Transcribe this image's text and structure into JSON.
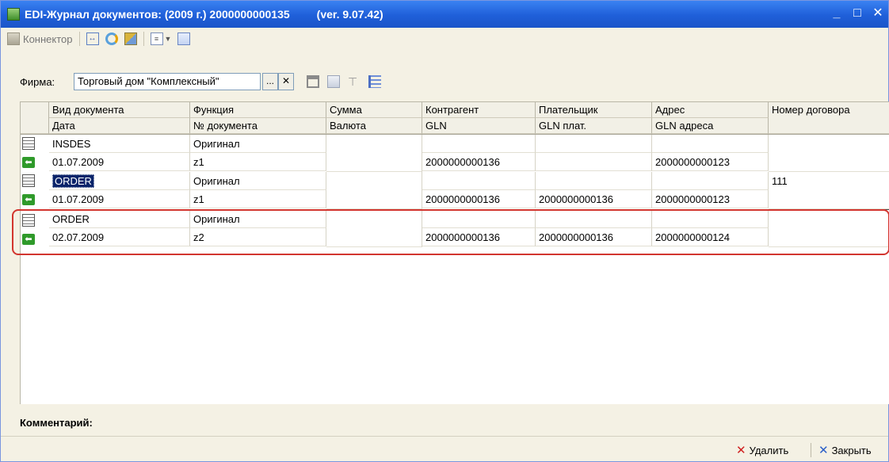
{
  "window": {
    "title": "EDI-Журнал документов: (2009 г.) 2000000000135",
    "version": "(ver. 9.07.42)",
    "minimize": "_",
    "maximize": "□",
    "close": "✕"
  },
  "toolbar": {
    "connector_label": "Коннектор"
  },
  "firm": {
    "label": "Фирма:",
    "value": "Торговый дом \"Комплексный\"",
    "pick_label": "...",
    "clear_label": "✕"
  },
  "table": {
    "headers_top": [
      "Вид документа",
      "Функция",
      "Сумма",
      "Контрагент",
      "Плательщик",
      "Адрес",
      "Номер договора"
    ],
    "headers_bottom": [
      "Дата",
      "№ документа",
      "Валюта",
      "GLN",
      "GLN плат.",
      "GLN адреса",
      ""
    ],
    "rows": [
      {
        "top": [
          "INSDES",
          "Оригинал",
          "",
          "",
          "",
          "",
          ""
        ],
        "bottom": [
          "01.07.2009",
          "z1",
          "",
          "2000000000136",
          "",
          "2000000000123",
          ""
        ]
      },
      {
        "top": [
          "ORDER",
          "Оригинал",
          "",
          "",
          "",
          "",
          "111"
        ],
        "bottom": [
          "01.07.2009",
          "z1",
          "",
          "2000000000136",
          "2000000000136",
          "2000000000123",
          ""
        ]
      },
      {
        "top": [
          "ORDER",
          "Оригинал",
          "",
          "",
          "",
          "",
          ""
        ],
        "bottom": [
          "02.07.2009",
          "z2",
          "",
          "2000000000136",
          "2000000000136",
          "2000000000124",
          ""
        ]
      }
    ]
  },
  "comment_label": "Комментарий:",
  "buttons": {
    "delete": "Удалить",
    "close": "Закрыть"
  }
}
